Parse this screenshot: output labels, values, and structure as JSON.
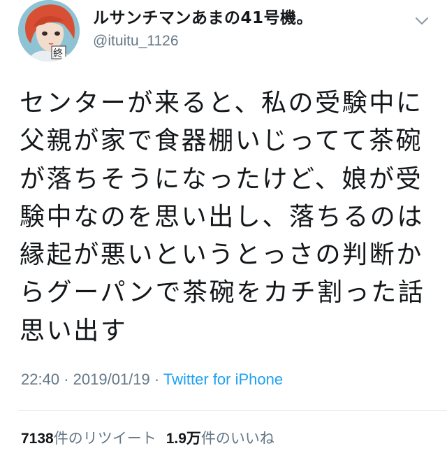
{
  "tweet": {
    "display_name": "ルサンチマンあまの41号機。",
    "handle": "@ituitu_1126",
    "avatar_badge": "終",
    "text_lines": [
      "センターが来ると、私の受験中に",
      "父親が家で食器棚いじってて茶碗",
      "が落ちそうになったけど、娘が受",
      "験中なのを思い出し、落ちるのは",
      "縁起が悪いというとっさの判断か",
      "らグーパンで茶碗をカチ割った話",
      "思い出す"
    ],
    "time": "22:40",
    "separator": "·",
    "date": "2019/01/19",
    "source": "Twitter for iPhone",
    "source_color": "#1da1f2"
  },
  "stats": {
    "retweets_count": "7138",
    "retweets_label": "件のリツイート",
    "likes_count": "1.9万",
    "likes_label": "件のいいね"
  },
  "icons": {
    "caret": "chevron-down-icon"
  }
}
